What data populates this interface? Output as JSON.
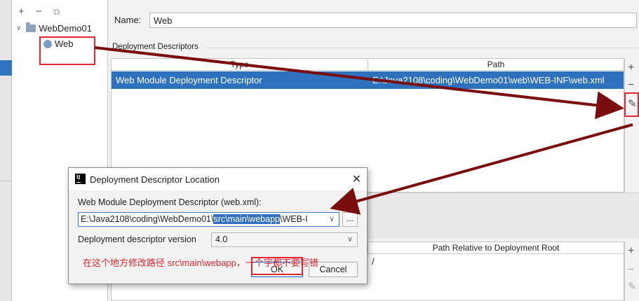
{
  "toolbar": {
    "add_label": "+",
    "remove_label": "−",
    "copy_label": "⧉"
  },
  "tree": {
    "root_label": "WebDemo01",
    "child_label": "Web"
  },
  "name_field": {
    "label_text": "Name:",
    "value": "Web"
  },
  "deployment_descriptors": {
    "section_label": "Deployment Descriptors",
    "columns": [
      "Type",
      "Path"
    ],
    "rows": [
      {
        "type": "Web Module Deployment Descriptor",
        "path": "E:\\Java2108\\coding\\WebDemo01\\web\\WEB-INF\\web.xml"
      }
    ],
    "side_buttons": {
      "add": "+",
      "remove": "−",
      "edit": "✎"
    }
  },
  "lower_table": {
    "columns": [
      "Path Relative to Deployment Root"
    ],
    "rows": [
      {
        "path": "/"
      }
    ],
    "side_buttons": {
      "add": "+",
      "remove": "−",
      "edit": "✎"
    }
  },
  "dialog": {
    "title": "Deployment Descriptor Location",
    "close": "✕",
    "field_label": "Web Module Deployment Descriptor (web.xml):",
    "path_before": "E:\\Java2108\\coding\\WebDemo01\\",
    "path_highlight": "src\\main\\webapp",
    "path_after": "\\WEB-I",
    "browse_label": "...",
    "version_label": "Deployment descriptor version",
    "version_value": "4.0",
    "ok_label": "OK",
    "cancel_label": "Cancel"
  },
  "annotation": {
    "note": "在这个地方修改路径  src\\main\\webapp，一个字都不要写错",
    "color": "#e2262f"
  },
  "colors": {
    "selection": "#2e72bd",
    "arrow": "#7a0d0d",
    "annotation_red": "#e2262f"
  }
}
